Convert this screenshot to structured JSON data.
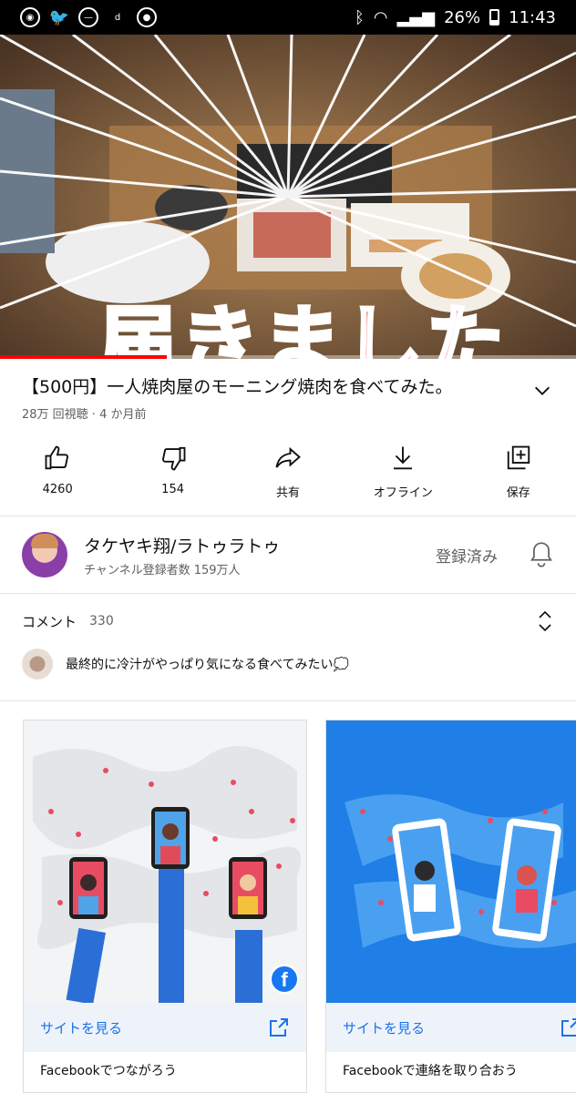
{
  "status_bar": {
    "battery": "26%",
    "time": "11:43"
  },
  "video": {
    "caption": "届きました",
    "progress": 0.29
  },
  "title": "【500円】一人焼肉屋のモーニング焼肉を食べてみた。",
  "meta": "28万 回視聴 · 4 か月前",
  "actions": [
    {
      "label": "4260",
      "icon": "thumbs-up-icon"
    },
    {
      "label": "154",
      "icon": "thumbs-down-icon"
    },
    {
      "label": "共有",
      "icon": "share-icon"
    },
    {
      "label": "オフライン",
      "icon": "download-icon"
    },
    {
      "label": "保存",
      "icon": "save-to-playlist-icon"
    }
  ],
  "channel": {
    "name": "タケヤキ翔/ラトゥラトゥ",
    "subscribers": "チャンネル登録者数 159万人",
    "subscribe_state": "登録済み"
  },
  "comments": {
    "label": "コメント",
    "count": "330",
    "top_comment": "最終的に冷汁がやっぱり気になる食べてみたい💭"
  },
  "ads": [
    {
      "cta": "サイトを見る",
      "description": "Facebookでつながろう"
    },
    {
      "cta": "サイトを見る",
      "description": "Facebookで連絡を取り合おう"
    }
  ],
  "colors": {
    "accent_red": "#ff0000",
    "link_blue": "#1a73e8",
    "facebook_blue": "#1877f2"
  }
}
